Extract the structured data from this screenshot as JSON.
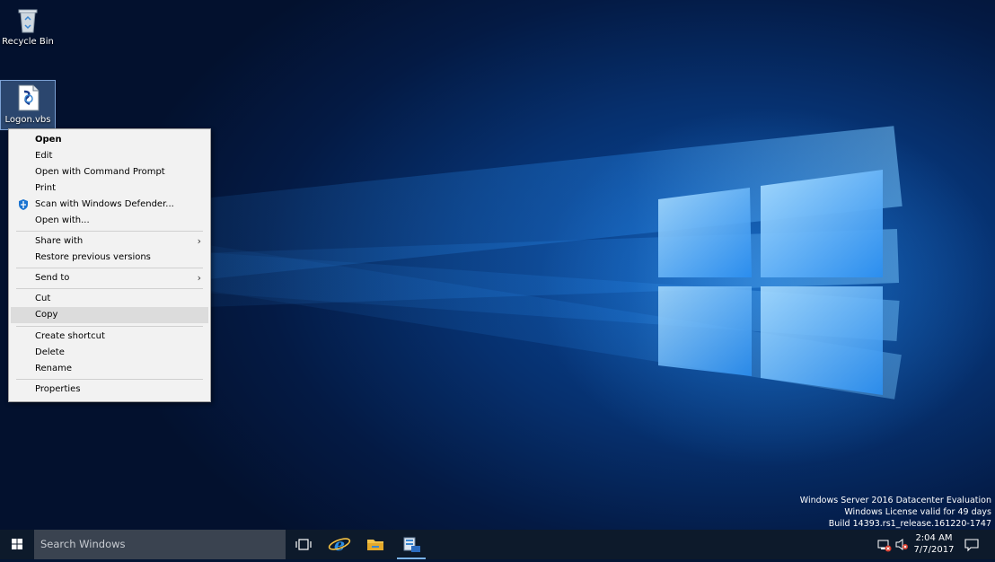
{
  "desktop": {
    "icons": [
      {
        "label": "Recycle Bin",
        "icon": "recycle-bin-icon"
      },
      {
        "label": "Logon.vbs",
        "icon": "vbscript-file-icon"
      }
    ]
  },
  "context_menu": {
    "items": {
      "open": "Open",
      "edit": "Edit",
      "open_cmd": "Open with Command Prompt",
      "print": "Print",
      "scan": "Scan with Windows Defender...",
      "open_with": "Open with...",
      "share_with": "Share with",
      "restore": "Restore previous versions",
      "send_to": "Send to",
      "cut": "Cut",
      "copy": "Copy",
      "create_shortcut": "Create shortcut",
      "delete": "Delete",
      "rename": "Rename",
      "properties": "Properties"
    },
    "highlighted": "Copy",
    "submenu_glyph": "›"
  },
  "watermark": {
    "line1": "Windows Server 2016 Datacenter Evaluation",
    "line2": "Windows License valid for 49 days",
    "line3": "Build 14393.rs1_release.161220-1747"
  },
  "taskbar": {
    "search_placeholder": "Search Windows",
    "pinned": [
      "task-view-icon",
      "internet-explorer-icon",
      "file-explorer-icon",
      "server-manager-icon"
    ],
    "clock": {
      "time": "2:04 AM",
      "date": "7/7/2017"
    }
  },
  "colors": {
    "accent": "#0078d7",
    "taskbar": "#0d1a2b",
    "search_box": "#3a4350",
    "menu_bg": "#f2f2f2",
    "menu_highlight": "#dcdcdc"
  }
}
